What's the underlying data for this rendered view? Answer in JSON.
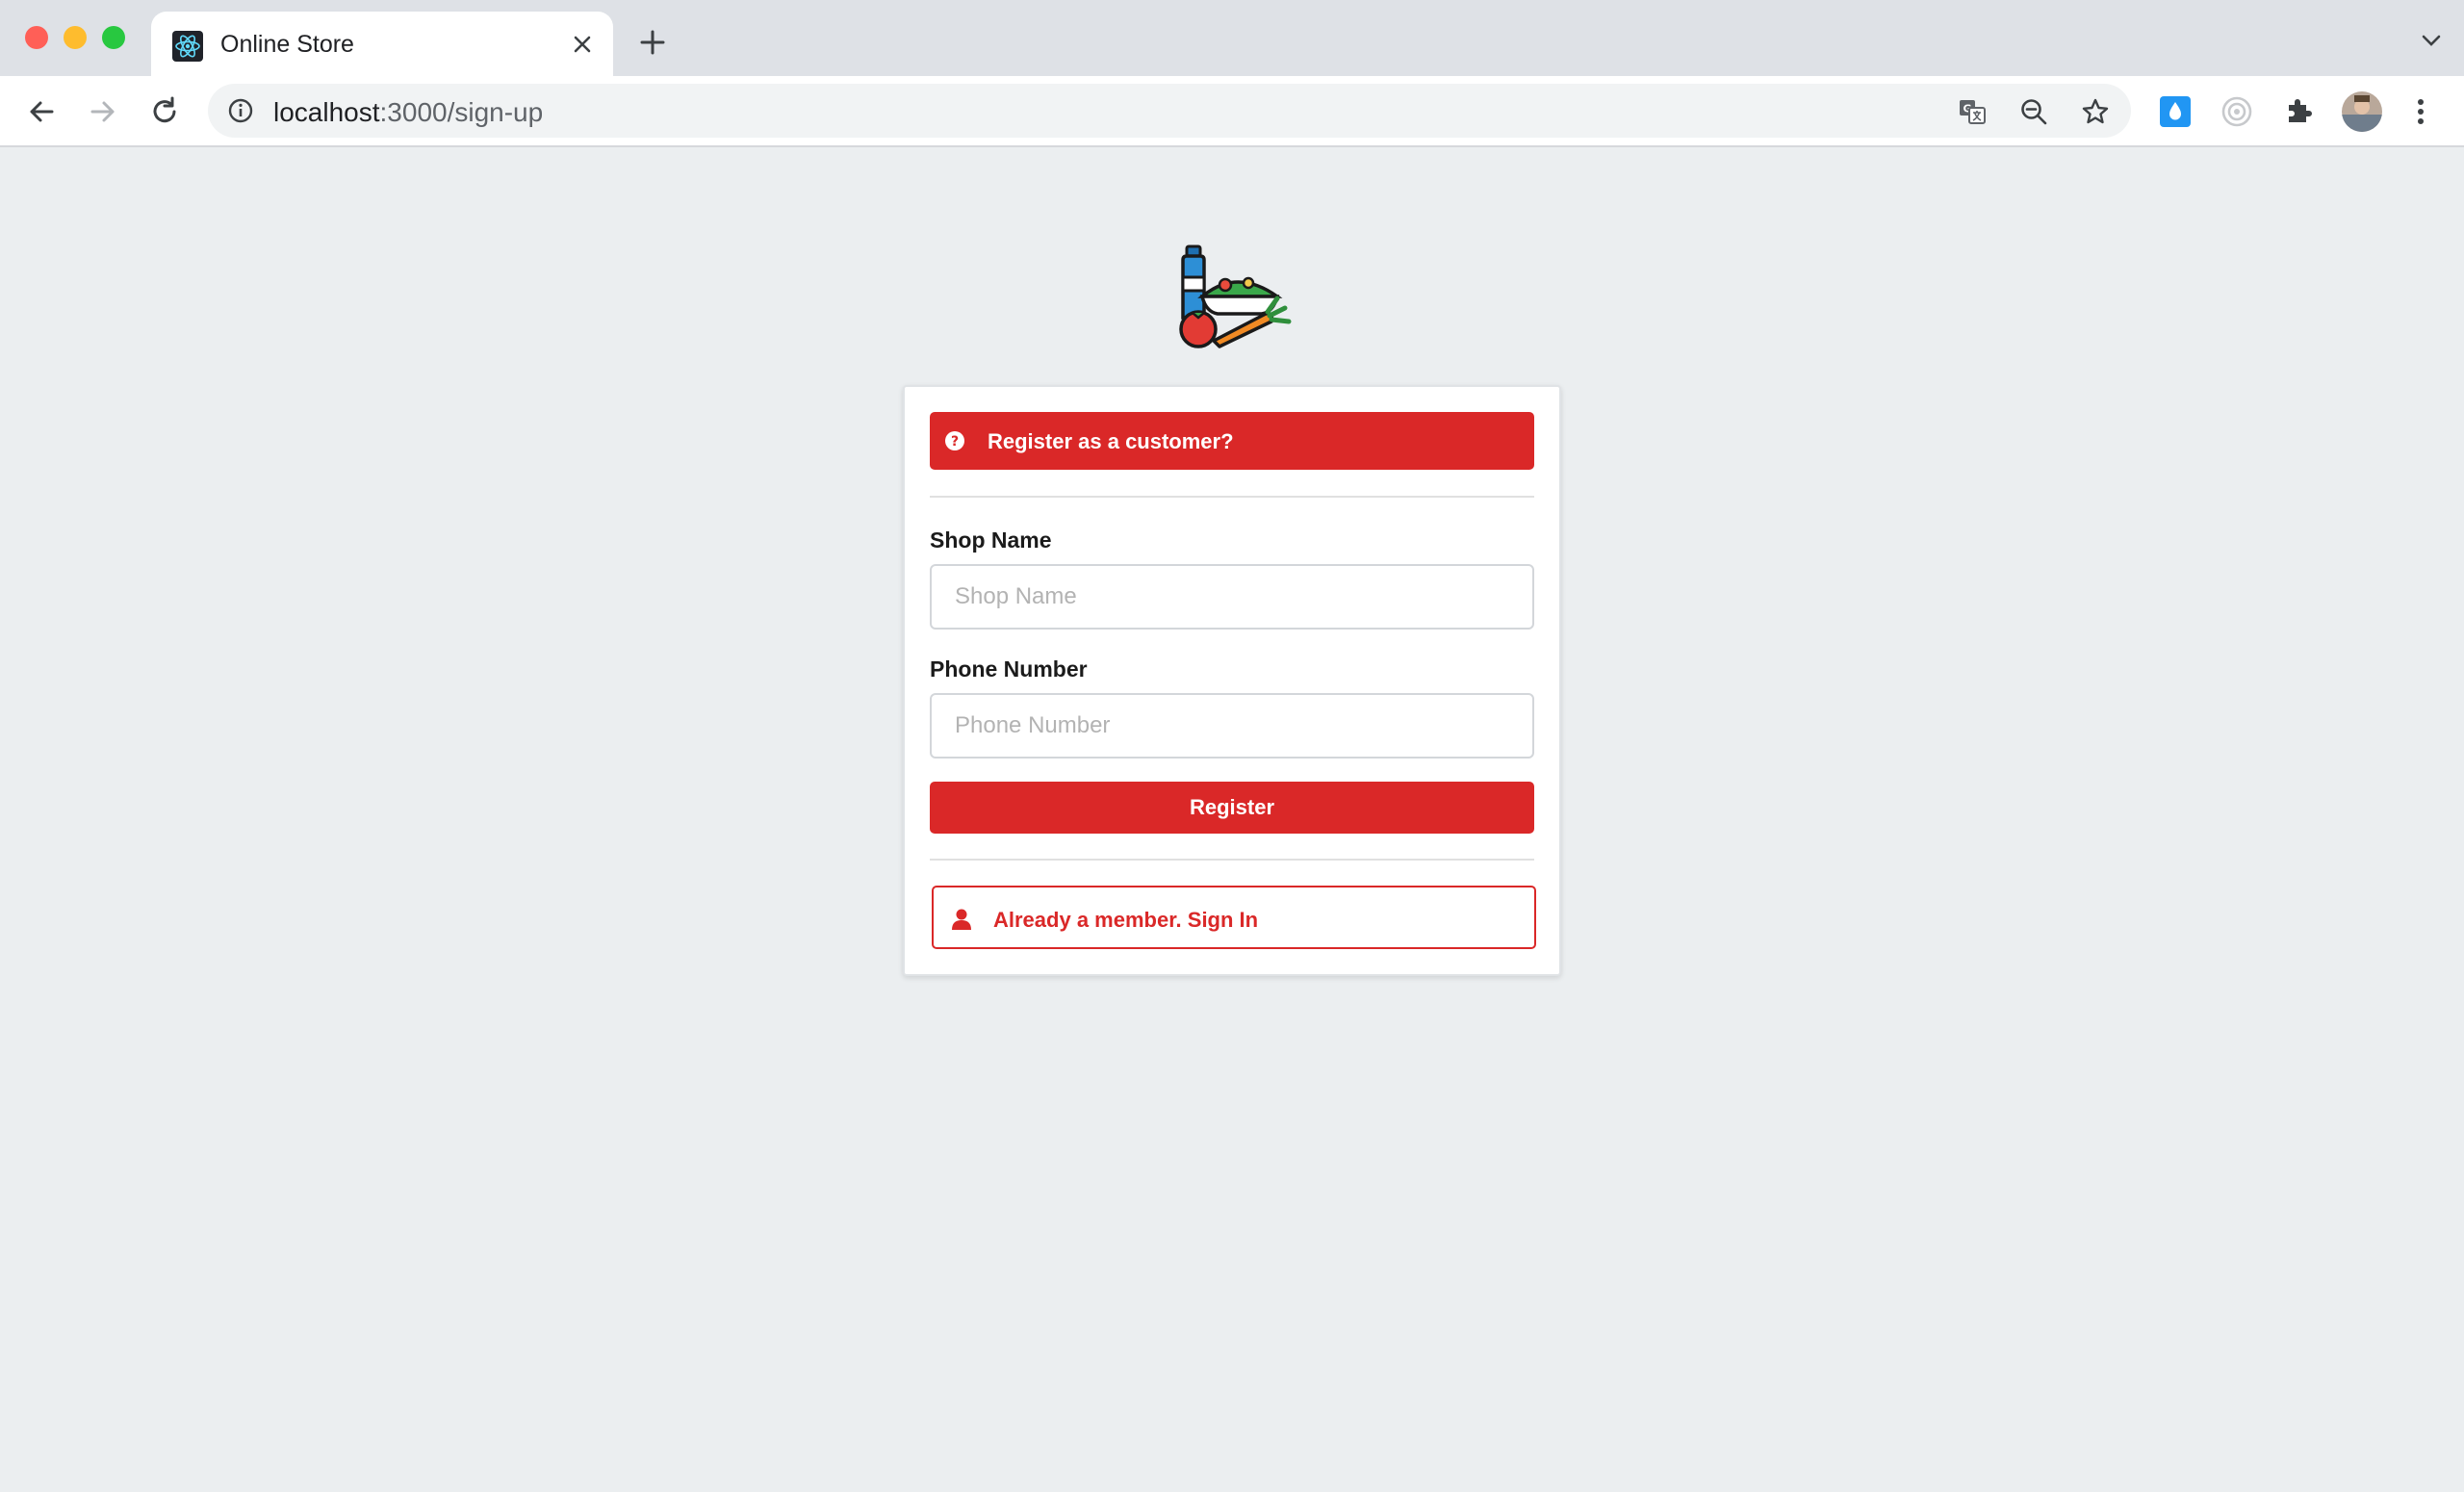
{
  "browser": {
    "tab_title": "Online Store",
    "url_host": "localhost",
    "url_path": ":3000/sign-up"
  },
  "form": {
    "customer_prompt": "Register as a customer?",
    "shop_name_label": "Shop Name",
    "shop_name_placeholder": "Shop Name",
    "shop_name_value": "",
    "phone_label": "Phone Number",
    "phone_placeholder": "Phone Number",
    "phone_value": "",
    "register_label": "Register",
    "signin_label": "Already a member. Sign In"
  },
  "colors": {
    "accent": "#da2828",
    "page_background": "#ebeef0"
  }
}
